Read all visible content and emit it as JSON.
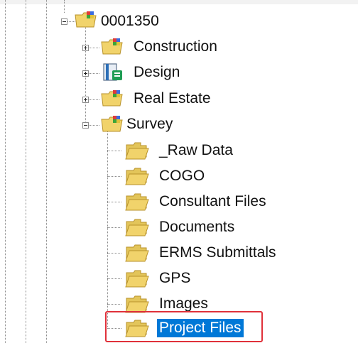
{
  "tree": {
    "root": {
      "label": "0001350",
      "icon": "multicolor-folder-icon",
      "expanded": true
    },
    "children": [
      {
        "label": "Construction",
        "icon": "multicolor-folder-icon",
        "expander": "plus"
      },
      {
        "label": "Design",
        "icon": "document-folder-icon",
        "expander": "plus"
      },
      {
        "label": "Real Estate",
        "icon": "multicolor-folder-icon",
        "expander": "plus"
      },
      {
        "label": "Survey",
        "icon": "multicolor-folder-icon",
        "expander": "minus"
      }
    ],
    "survey_children": [
      {
        "label": "_Raw Data",
        "icon": "folder-icon"
      },
      {
        "label": "COGO",
        "icon": "folder-icon"
      },
      {
        "label": "Consultant Files",
        "icon": "folder-icon"
      },
      {
        "label": "Documents",
        "icon": "folder-icon"
      },
      {
        "label": "ERMS Submittals",
        "icon": "folder-icon"
      },
      {
        "label": "GPS",
        "icon": "folder-icon"
      },
      {
        "label": "Images",
        "icon": "folder-icon"
      },
      {
        "label": "Project Files",
        "icon": "folder-icon",
        "selected": true
      }
    ]
  },
  "colors": {
    "selection": "#0078d7",
    "highlight_box": "#e0313a",
    "folder": "#f1d36b"
  }
}
